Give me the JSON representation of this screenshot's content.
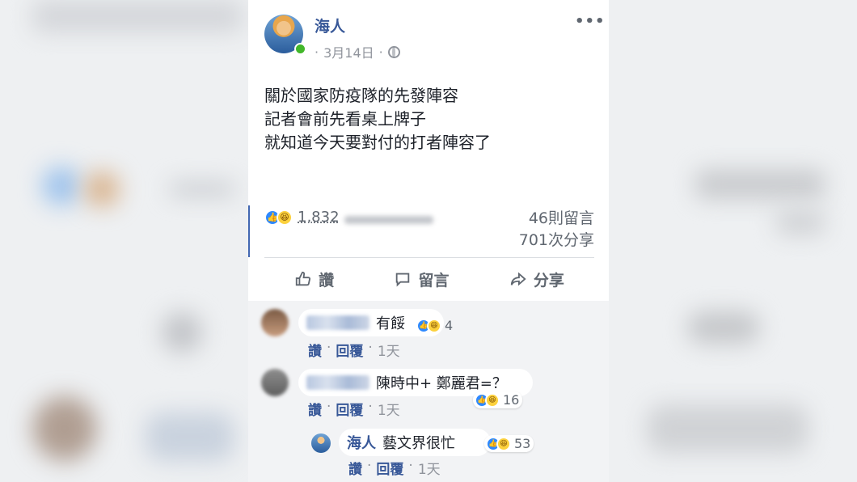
{
  "post": {
    "author": "海人",
    "date": "3月14日",
    "separator": "·",
    "more": "•••",
    "body_lines": [
      "關於國家防疫隊的先發陣容",
      "記者會前先看桌上牌子",
      "就知道今天要對付的打者陣容了"
    ],
    "reactions_count": "1,832",
    "comments_count": "46則留言",
    "shares_count": "701次分享",
    "reaction_icons": [
      "like-icon",
      "haha-icon"
    ]
  },
  "actions": {
    "like": "讚",
    "comment": "留言",
    "share": "分享"
  },
  "comments": [
    {
      "text": "有餒",
      "reactions": "4",
      "like": "讚",
      "reply": "回覆",
      "time": "1天",
      "sep": "·"
    },
    {
      "text": "陳時中+ 鄭麗君=？",
      "reactions": "16",
      "like": "讚",
      "reply": "回覆",
      "time": "1天",
      "sep": "·"
    }
  ],
  "reply": {
    "author": "海人",
    "text": "藝文界很忙",
    "reactions": "53",
    "like": "讚",
    "reply": "回覆",
    "time": "1天",
    "sep": "·"
  },
  "colors": {
    "link": "#385898",
    "like_blue": "#2e89ff",
    "haha_yellow": "#fcd13d",
    "online": "#42b72a"
  }
}
